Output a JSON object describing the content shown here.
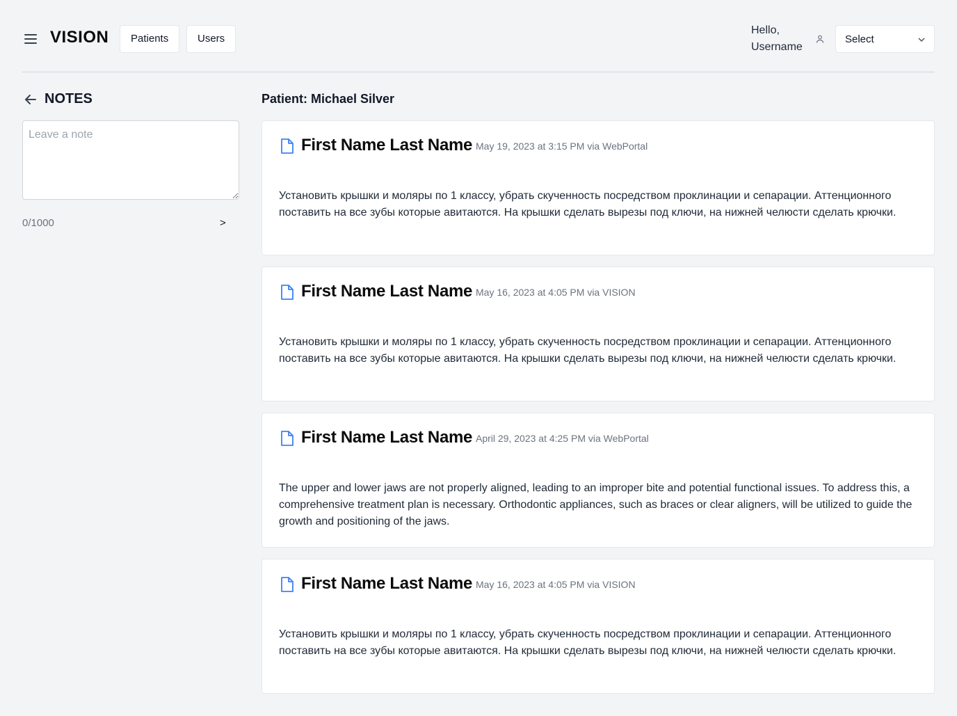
{
  "header": {
    "logo": "VISION",
    "nav": [
      {
        "label": "Patients"
      },
      {
        "label": "Users"
      }
    ],
    "greeting_line1": "Hello,",
    "greeting_line2": "Username",
    "select_value": "Select"
  },
  "notes_panel": {
    "title": "NOTES",
    "placeholder": "Leave a note",
    "counter": "0/1000",
    "submit_label": ">"
  },
  "main": {
    "patient_label": "Patient: Michael Silver",
    "notes": [
      {
        "author": "First Name Last Name",
        "meta": "May 19, 2023 at 3:15 PM via WebPortal",
        "text": "Установить крышки и моляры по 1 классу, убрать скученность посредством проклинации и сепарации. Аттенционного поставить на все зубы которые авитаются. На крышки сделать вырезы под ключи, на нижней челюсти сделать крючки."
      },
      {
        "author": "First Name Last Name",
        "meta": "May 16, 2023 at 4:05 PM via VISION",
        "text": "Установить крышки и моляры по 1 классу, убрать скученность посредством проклинации и сепарации. Аттенционного поставить на все зубы которые авитаются. На крышки сделать вырезы под ключи, на нижней челюсти сделать крючки."
      },
      {
        "author": "First Name Last Name",
        "meta": "April 29, 2023 at 4:25 PM via WebPortal",
        "text": "The upper and lower jaws are not properly aligned, leading to an improper bite and potential functional issues. To address this, a comprehensive treatment plan is necessary. Orthodontic appliances, such as braces or clear aligners, will be utilized to guide the growth and positioning of the jaws."
      },
      {
        "author": "First Name Last Name",
        "meta": "May 16, 2023 at 4:05 PM via VISION",
        "text": "Установить крышки и моляры по 1 классу, убрать скученность посредством проклинации и сепарации. Аттенционного поставить на все зубы которые авитаются. На крышки сделать вырезы под ключи, на нижней челюсти сделать крючки."
      }
    ]
  },
  "colors": {
    "background": "#f3f4f6",
    "card": "#ffffff",
    "doc_icon": "#3b82f6",
    "meta_text": "#6b7280"
  },
  "icons": [
    "menu-icon",
    "user-icon",
    "chevron-down-icon",
    "arrow-left-icon",
    "document-icon"
  ]
}
